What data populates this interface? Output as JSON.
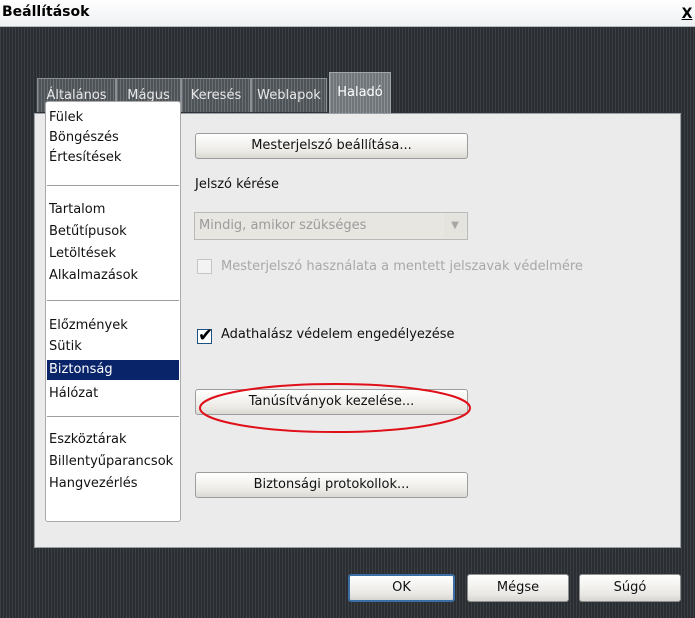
{
  "window": {
    "title": "Beállítások",
    "close_glyph": "X"
  },
  "tabs": [
    {
      "label": "Általános"
    },
    {
      "label": "Mágus"
    },
    {
      "label": "Keresés"
    },
    {
      "label": "Weblapok"
    },
    {
      "label": "Haladó",
      "active": true
    }
  ],
  "categories": {
    "group1": [
      "Fülek",
      "Böngészés",
      "Értesítések"
    ],
    "group2": [
      "Tartalom",
      "Betűtípusok",
      "Letöltések",
      "Alkalmazások"
    ],
    "group3": [
      "Előzmények",
      "Sütik",
      "Biztonság",
      "Hálózat"
    ],
    "group4": [
      "Eszköztárak",
      "Billentyűparancsok",
      "Hangvezérlés"
    ],
    "selected": "Biztonság"
  },
  "security": {
    "master_password_button": "Mesterjelszó beállítása...",
    "ask_password_label": "Jelszó kérése",
    "ask_password_select_value": "Mindig, amikor szükséges",
    "master_password_protect_checkbox": {
      "label": "Mesterjelszó használata a mentett jelszavak védelmére",
      "checked": false,
      "enabled": false
    },
    "phishing_checkbox": {
      "label": "Adathalász védelem engedélyezése",
      "checked": true
    },
    "manage_certificates_button": "Tanúsítványok kezelése...",
    "security_protocols_button": "Biztonsági protokollok..."
  },
  "footer": {
    "ok": "OK",
    "cancel": "Mégse",
    "help": "Súgó"
  },
  "colors": {
    "selection": "#0a246a",
    "highlight_ellipse": "#e0101a"
  },
  "icons": {
    "close": "close-icon",
    "checkmark": "checkmark-icon",
    "dropdown": "chevron-down-icon"
  }
}
